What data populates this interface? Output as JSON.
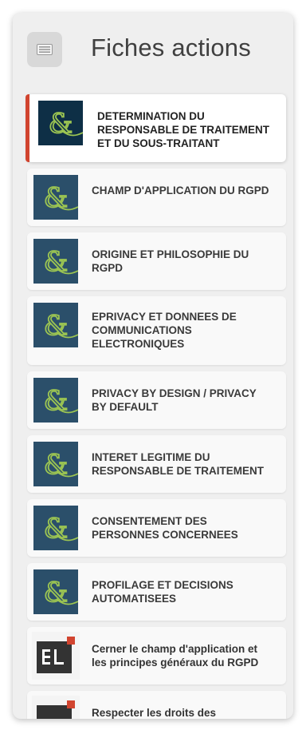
{
  "header": {
    "title": "Fiches actions",
    "menu_icon": "newspaper-icon"
  },
  "accent_color": "#d1442f",
  "items": [
    {
      "label": "DETERMINATION DU RESPONSABLE DE TRAITEMENT ET DU SOUS-TRAITANT",
      "icon": "ampersand-logo-icon",
      "active": true
    },
    {
      "label": "CHAMP D'APPLICATION DU RGPD",
      "icon": "ampersand-logo-icon",
      "active": false
    },
    {
      "label": "ORIGINE ET PHILOSOPHIE DU RGPD",
      "icon": "ampersand-logo-icon",
      "active": false
    },
    {
      "label": "EPRIVACY ET DONNEES DE COMMUNICATIONS ELECTRONIQUES",
      "icon": "ampersand-logo-icon",
      "active": false
    },
    {
      "label": "PRIVACY BY DESIGN / PRIVACY BY DEFAULT",
      "icon": "ampersand-logo-icon",
      "active": false
    },
    {
      "label": "INTERET LEGITIME DU RESPONSABLE DE TRAITEMENT",
      "icon": "ampersand-logo-icon",
      "active": false
    },
    {
      "label": "CONSENTEMENT DES PERSONNES CONCERNEES",
      "icon": "ampersand-logo-icon",
      "active": false
    },
    {
      "label": "PROFILAGE ET DECISIONS AUTOMATISEES",
      "icon": "ampersand-logo-icon",
      "active": false
    },
    {
      "label": "Cerner le champ d'application et les principes généraux du RGPD",
      "icon": "el-logo-icon",
      "active": false
    },
    {
      "label": "Respecter les droits des",
      "icon": "el-logo-icon",
      "active": false
    }
  ]
}
